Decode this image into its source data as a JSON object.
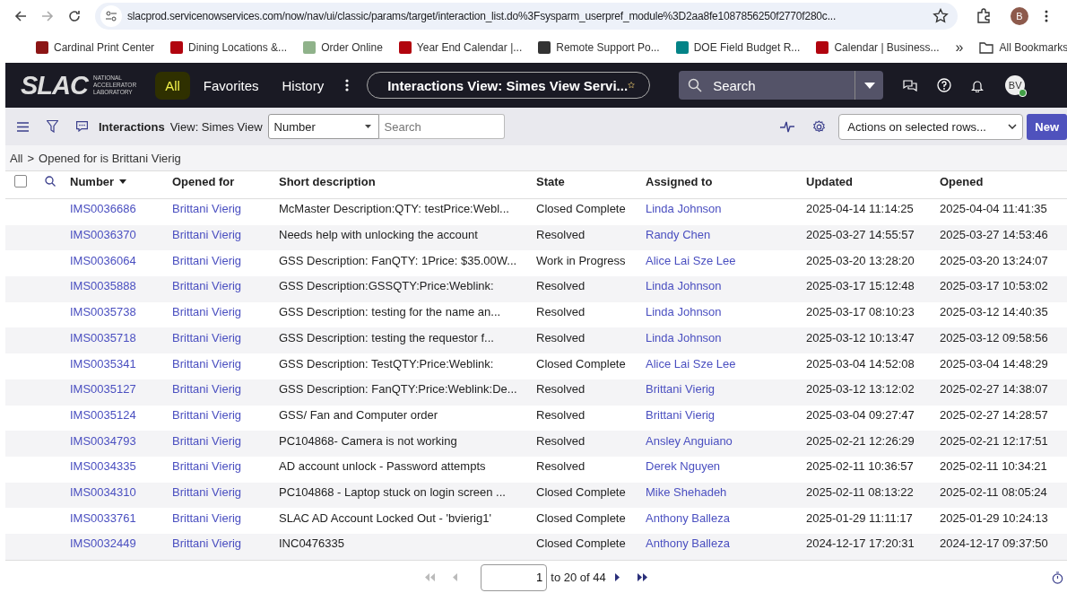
{
  "browser": {
    "url": "slacprod.servicenowservices.com/now/nav/ui/classic/params/target/interaction_list.do%3Fsysparm_userpref_module%3D2aa8fe1087856250f2770f280c...",
    "profile_initial": "B",
    "bookmarks": [
      {
        "label": "Cardinal Print Center",
        "color": "#8c1515"
      },
      {
        "label": "Dining Locations &...",
        "color": "#b1040e"
      },
      {
        "label": "Order Online",
        "color": "#8fb28a"
      },
      {
        "label": "Year End Calendar |...",
        "color": "#b1040e"
      },
      {
        "label": "Remote Support Po...",
        "color": "#333333"
      },
      {
        "label": "DOE Field Budget R...",
        "color": "#038387"
      },
      {
        "label": "Calendar | Business...",
        "color": "#b1040e"
      }
    ],
    "more": "»",
    "all_bookmarks": "All Bookmarks"
  },
  "header": {
    "logo_word": "SLAC",
    "logo_sub": [
      "NATIONAL",
      "ACCELERATOR",
      "LABORATORY"
    ],
    "nav": [
      {
        "label": "All",
        "highlighted": true
      },
      {
        "label": "Favorites",
        "highlighted": false
      },
      {
        "label": "History",
        "highlighted": false
      }
    ],
    "context_title": "Interactions View: Simes View Servi...",
    "search_placeholder": "Search",
    "avatar": "BV"
  },
  "toolbar": {
    "title": "Interactions",
    "view": "View: Simes View",
    "field_select": "Number",
    "search_placeholder": "Search",
    "actions": "Actions on selected rows...",
    "new_button": "New"
  },
  "breadcrumb": {
    "root": "All",
    "separator": ">",
    "filter": "Opened for is Brittani Vierig"
  },
  "table": {
    "select_all_checked": false,
    "columns": [
      {
        "label": "Number",
        "sorted": true
      },
      {
        "label": "Opened for",
        "sorted": false
      },
      {
        "label": "Short description",
        "sorted": false
      },
      {
        "label": "State",
        "sorted": false
      },
      {
        "label": "Assigned to",
        "sorted": false
      },
      {
        "label": "Updated",
        "sorted": false
      },
      {
        "label": "Opened",
        "sorted": false
      }
    ],
    "rows": [
      [
        "IMS0036686",
        "Brittani Vierig",
        "McMaster Description:QTY: testPrice:Webl...",
        "Closed Complete",
        "Linda Johnson",
        "2025-04-14 11:14:25",
        "2025-04-04 11:41:35"
      ],
      [
        "IMS0036370",
        "Brittani Vierig",
        "Needs help with unlocking the account",
        "Resolved",
        "Randy Chen",
        "2025-03-27 14:55:57",
        "2025-03-27 14:53:46"
      ],
      [
        "IMS0036064",
        "Brittani Vierig",
        "GSS Description: FanQTY: 1Price: $35.00W...",
        "Work in Progress",
        "Alice Lai Sze Lee",
        "2025-03-20 13:28:20",
        "2025-03-20 13:24:07"
      ],
      [
        "IMS0035888",
        "Brittani Vierig",
        "GSS Description:GSSQTY:Price:Weblink:",
        "Resolved",
        "Linda Johnson",
        "2025-03-17 15:12:48",
        "2025-03-17 10:53:02"
      ],
      [
        "IMS0035738",
        "Brittani Vierig",
        "GSS Description: testing for the name an...",
        "Resolved",
        "Linda Johnson",
        "2025-03-17 08:10:23",
        "2025-03-12 14:40:35"
      ],
      [
        "IMS0035718",
        "Brittani Vierig",
        "GSS Description: testing the requestor f...",
        "Resolved",
        "Linda Johnson",
        "2025-03-12 10:13:47",
        "2025-03-12 09:58:56"
      ],
      [
        "IMS0035341",
        "Brittani Vierig",
        "GSS Description: TestQTY:Price:Weblink:",
        "Closed Complete",
        "Alice Lai Sze Lee",
        "2025-03-04 14:52:08",
        "2025-03-04 14:48:29"
      ],
      [
        "IMS0035127",
        "Brittani Vierig",
        "GSS Description: FanQTY:Price:Weblink:De...",
        "Resolved",
        "Brittani Vierig",
        "2025-03-12 13:12:02",
        "2025-02-27 14:38:07"
      ],
      [
        "IMS0035124",
        "Brittani Vierig",
        "GSS/ Fan and Computer order",
        "Resolved",
        "Brittani Vierig",
        "2025-03-04 09:27:47",
        "2025-02-27 14:28:57"
      ],
      [
        "IMS0034793",
        "Brittani Vierig",
        "PC104868- Camera is not working",
        "Resolved",
        "Ansley Anguiano",
        "2025-02-21 12:26:29",
        "2025-02-21 12:17:51"
      ],
      [
        "IMS0034335",
        "Brittani Vierig",
        "AD account unlock - Password attempts",
        "Resolved",
        "Derek Nguyen",
        "2025-02-11 10:36:57",
        "2025-02-11 10:34:21"
      ],
      [
        "IMS0034310",
        "Brittani Vierig",
        "PC104868 - Laptop stuck on login screen ...",
        "Closed Complete",
        "Mike Shehadeh",
        "2025-02-11 08:13:22",
        "2025-02-11 08:05:24"
      ],
      [
        "IMS0033761",
        "Brittani Vierig",
        "SLAC AD Account Locked Out - 'bvierig1'",
        "Closed Complete",
        "Anthony Balleza",
        "2025-01-29 11:11:17",
        "2025-01-29 10:24:13"
      ],
      [
        "IMS0032449",
        "Brittani Vierig",
        "INC0476335",
        "Closed Complete",
        "Anthony Balleza",
        "2024-12-17 17:20:31",
        "2024-12-17 09:37:50"
      ]
    ]
  },
  "pager": {
    "page": "1",
    "range": "to 20 of 44"
  }
}
